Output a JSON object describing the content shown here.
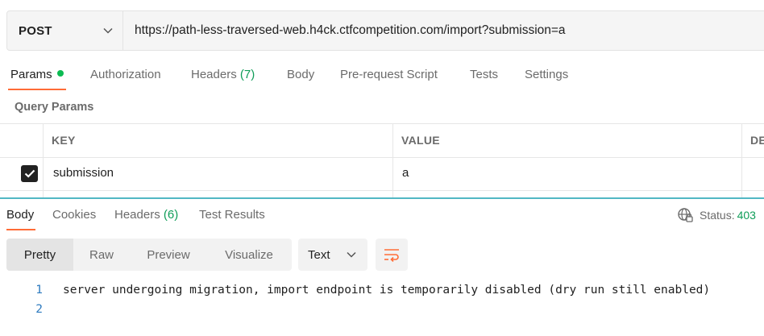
{
  "request": {
    "method": "POST",
    "url": "https://path-less-traversed-web.h4ck.ctfcompetition.com/import?submission=a"
  },
  "request_tabs": [
    {
      "label": "Params",
      "active": true,
      "dot": true
    },
    {
      "label": "Authorization"
    },
    {
      "label": "Headers",
      "count": "(7)"
    },
    {
      "label": "Body"
    },
    {
      "label": "Pre-request Script"
    },
    {
      "label": "Tests"
    },
    {
      "label": "Settings"
    }
  ],
  "query_params": {
    "title": "Query Params",
    "columns": [
      "KEY",
      "VALUE",
      "DE"
    ],
    "rows": [
      {
        "checked": true,
        "key": "submission",
        "value": "a"
      }
    ]
  },
  "response_tabs": [
    {
      "label": "Body",
      "active": true
    },
    {
      "label": "Cookies"
    },
    {
      "label": "Headers",
      "count": "(6)"
    },
    {
      "label": "Test Results"
    }
  ],
  "status": {
    "label": "Status:",
    "value": "403"
  },
  "view_modes": [
    "Pretty",
    "Raw",
    "Preview",
    "Visualize"
  ],
  "active_view_mode": "Pretty",
  "format": "Text",
  "body_lines": [
    {
      "num": "1",
      "text": "server undergoing migration, import endpoint is temporarily disabled (dry run still enabled)"
    },
    {
      "num": "2",
      "text": ""
    }
  ],
  "colors": {
    "accent": "#ff6c37",
    "success": "#0f9d58",
    "divider": "#52b7c4"
  }
}
